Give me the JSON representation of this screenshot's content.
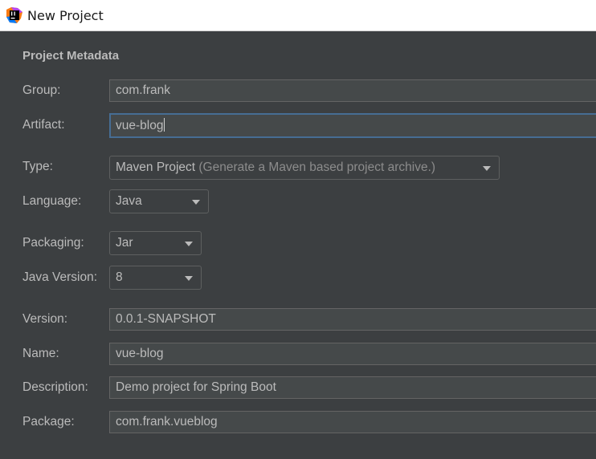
{
  "window": {
    "title": "New Project",
    "icon": "intellij-idea-icon"
  },
  "section": {
    "title": "Project Metadata"
  },
  "form": {
    "group": {
      "label": "Group:",
      "value": "com.frank"
    },
    "artifact": {
      "label": "Artifact:",
      "value": "vue-blog"
    },
    "type": {
      "label": "Type:",
      "value": "Maven Project",
      "hint": "(Generate a Maven based project archive.)"
    },
    "language": {
      "label": "Language:",
      "value": "Java"
    },
    "packaging": {
      "label": "Packaging:",
      "value": "Jar"
    },
    "java_version": {
      "label": "Java Version:",
      "value": "8"
    },
    "version": {
      "label": "Version:",
      "value": "0.0.1-SNAPSHOT"
    },
    "name": {
      "label": "Name:",
      "value": "vue-blog"
    },
    "description": {
      "label": "Description:",
      "value": "Demo project for Spring Boot"
    },
    "package": {
      "label": "Package:",
      "value": "com.frank.vueblog"
    }
  },
  "colors": {
    "background": "#3c3f41",
    "field_bg": "#45494a",
    "focus_border": "#466d94",
    "text": "#bbbbbb"
  }
}
